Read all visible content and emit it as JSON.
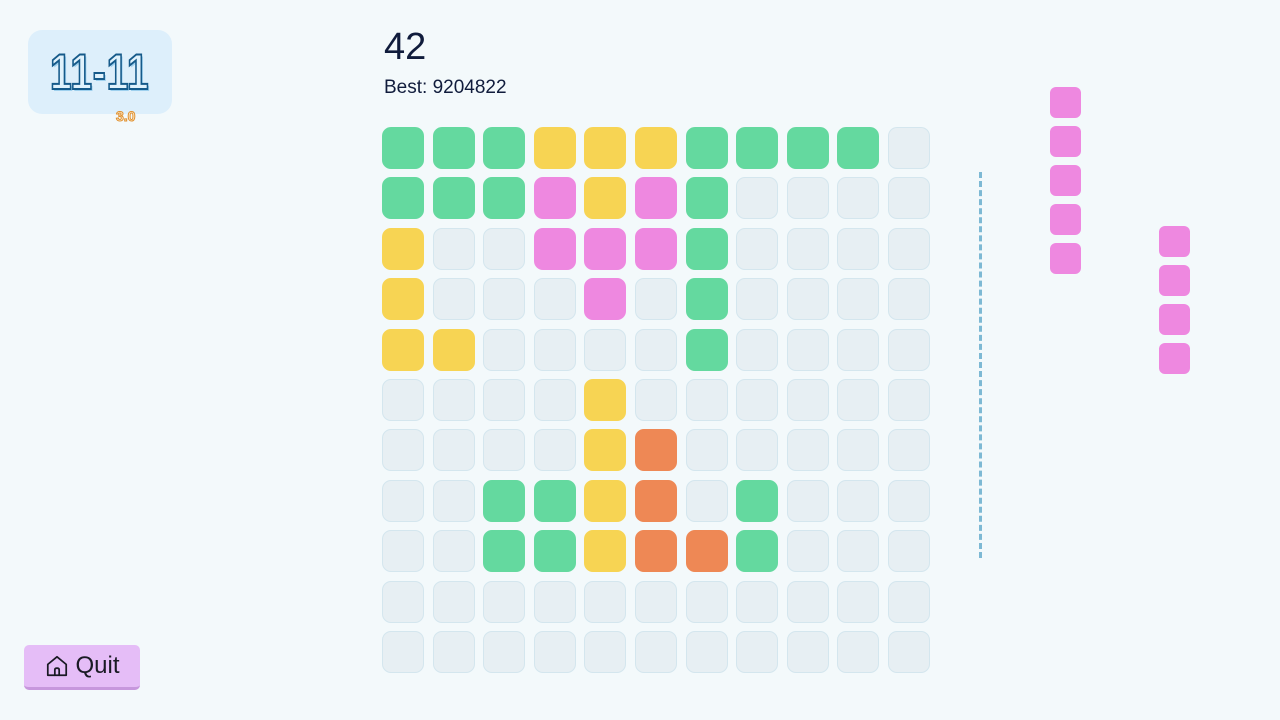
{
  "logo": {
    "text": "11-11",
    "version": "3.0"
  },
  "score": {
    "current": "42",
    "best_label": "Best: 9204822"
  },
  "board": {
    "rows": 11,
    "cols": 11,
    "colors": {
      "g": "#64D99F",
      "y": "#F7D453",
      "p": "#EE88E0",
      "o": "#EE8855",
      "empty": "#E7EFF3"
    },
    "grid": [
      "gggyyygggg.",
      "gggpypg....",
      "y..pppg....",
      "y...p.g....",
      "yy....g....",
      "....y......",
      "....yo.....",
      "..ggyo.g...",
      "..ggyoog...",
      "...........",
      "..........."
    ]
  },
  "pieces": [
    {
      "color": "#EE88E0",
      "orientation": "vertical",
      "length": 5
    },
    {
      "color": "#EE88E0",
      "orientation": "vertical",
      "length": 4
    }
  ],
  "quit_button": {
    "label": "Quit",
    "icon": "home-icon"
  }
}
